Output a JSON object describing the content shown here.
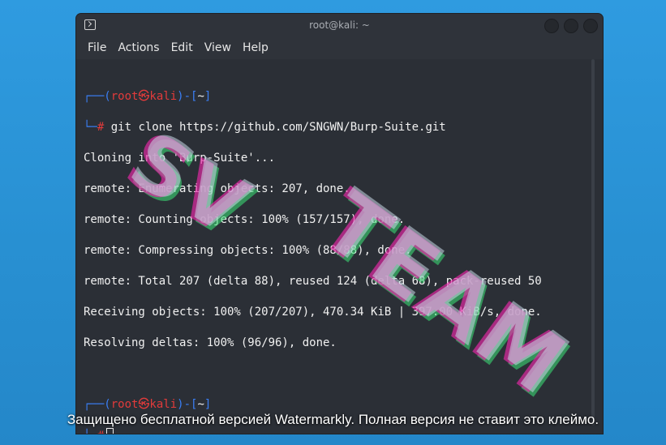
{
  "window": {
    "title": "root@kali: ~",
    "icon": "terminal-icon"
  },
  "menu": {
    "items": [
      "File",
      "Actions",
      "Edit",
      "View",
      "Help"
    ]
  },
  "terminal": {
    "prompt1": {
      "open": "┌──(",
      "user": "root㉿kali",
      "close": ")-[",
      "dir": "~",
      "end": "]"
    },
    "prompt1_line2": {
      "lead": "└─",
      "hash": "#",
      "command": " git clone https://github.com/SNGWN/Burp-Suite.git"
    },
    "output": [
      "Cloning into 'Burp-Suite'...",
      "remote: Enumerating objects: 207, done.",
      "remote: Counting objects: 100% (157/157), done.",
      "remote: Compressing objects: 100% (88/88), done.",
      "remote: Total 207 (delta 88), reused 124 (delta 68), pack-reused 50",
      "Receiving objects: 100% (207/207), 470.34 KiB | 397.00 KiB/s, done.",
      "Resolving deltas: 100% (96/96), done."
    ],
    "prompt2": {
      "open": "┌──(",
      "user": "root㉿kali",
      "close": ")-[",
      "dir": "~",
      "end": "]"
    },
    "prompt2_line2": {
      "lead": "└─",
      "hash": "#"
    }
  },
  "watermark": {
    "line1": "SV",
    "line2": "TEAM",
    "caption": "Защищено бесплатной версией Watermarkly. Полная версия не ставит это клеймо."
  },
  "colors": {
    "desktop": "#2a93d5",
    "terminal_bg": "#2b2f36",
    "prompt_blue": "#3a7ff6",
    "prompt_red": "#e23b3b"
  }
}
